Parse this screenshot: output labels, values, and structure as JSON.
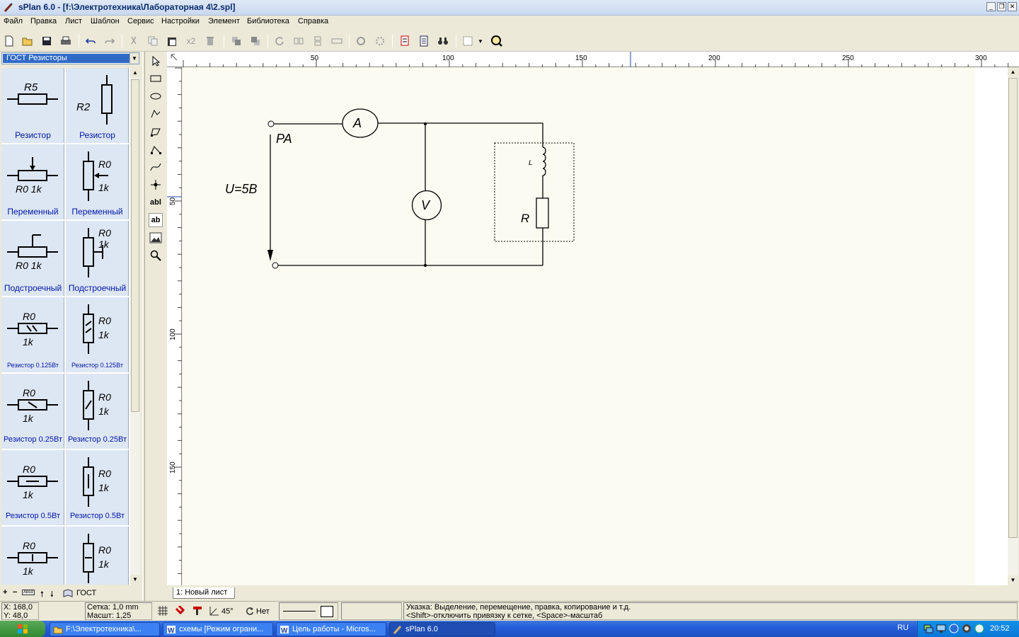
{
  "window": {
    "title": "sPlan 6.0 - [f:\\Электротехника\\Лабораторная 4\\2.spl]"
  },
  "menu": [
    "Файл",
    "Правка",
    "Лист",
    "Шаблон",
    "Сервис",
    "Настройки",
    "Элемент",
    "Библиотека",
    "Справка"
  ],
  "toolbar": {
    "x2_label": "x2"
  },
  "library": {
    "selected": "ГОСТ Резисторы",
    "items": [
      {
        "label": "Резистор"
      },
      {
        "label": "Резистор"
      },
      {
        "label": "Переменный"
      },
      {
        "label": "Переменный"
      },
      {
        "label": "Подстроечный"
      },
      {
        "label": "Подстроечный"
      },
      {
        "label": "Резистор 0.125Вт"
      },
      {
        "label": "Резистор 0.125Вт"
      },
      {
        "label": "Резистор 0.25Вт"
      },
      {
        "label": "Резистор 0.25Вт"
      },
      {
        "label": "Резистор 0.5Вт"
      },
      {
        "label": "Резистор 0.5Вт"
      }
    ],
    "symbol_text": {
      "r5": "R5",
      "r2": "R2",
      "r0": "R0",
      "k1": "1k",
      "r0_1k": "R0 1k",
      "r0_1k_spaced": "R0  1k"
    },
    "footer_label": "ГОСТ",
    "footer_abcd": "Abcd"
  },
  "tools": {
    "text_tool": "abl",
    "text_tool2": "ab"
  },
  "ruler": {
    "top_ticks": [
      "50",
      "100",
      "150",
      "200",
      "250",
      "300"
    ],
    "left_ticks": [
      "50",
      "100",
      "150"
    ]
  },
  "schematic": {
    "labels": {
      "pa": "PA",
      "voltage": "U=5В",
      "ammeter": "A",
      "voltmeter": "V",
      "inductor": "L",
      "resistor": "R"
    }
  },
  "sheet_tab": "1: Новый лист",
  "status": {
    "x": "X: 168,0",
    "y": "Y: 48,0",
    "grid": "Сетка:  1,0 mm",
    "scale": "Масшт:  1,25",
    "angle": "45°",
    "snap": "Нет",
    "hint1": "Указка: Выделение, перемещение, правка, копирование и т.д.",
    "hint2": "<Shift>-отключить привязку к сетке, <Space>-масштаб"
  },
  "taskbar": {
    "items": [
      {
        "label": "F:\\Электротехника\\..."
      },
      {
        "label": "схемы [Режим ограни..."
      },
      {
        "label": "Цель работы - Micros..."
      },
      {
        "label": "sPlan 6.0"
      }
    ],
    "lang": "RU",
    "clock": "20:52"
  },
  "colors": {
    "accent": "#316ac5",
    "canvas": "#fbfbf1",
    "lib_label": "#0016a6"
  }
}
